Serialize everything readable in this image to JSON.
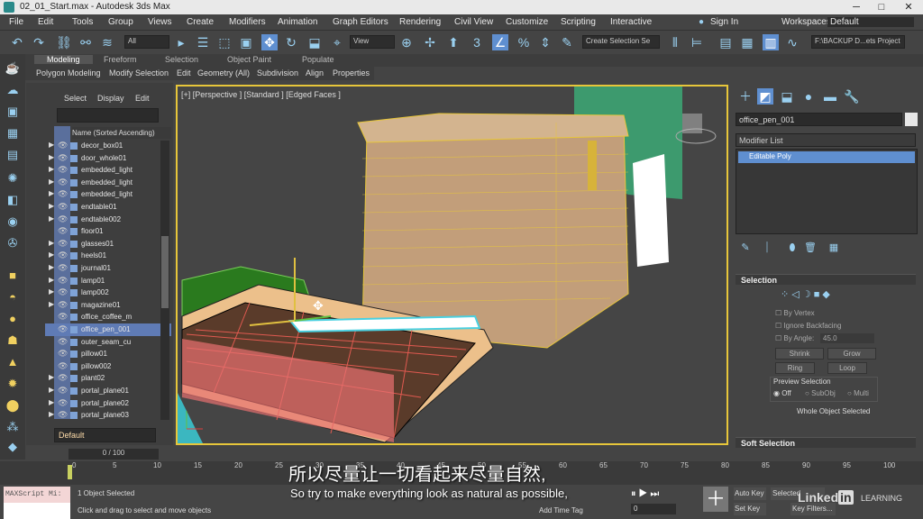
{
  "titlebar": {
    "title": "02_01_Start.max - Autodesk 3ds Max",
    "minimize": "─",
    "maximize": "□",
    "close": "✕"
  },
  "menu": [
    "File",
    "Edit",
    "Tools",
    "Group",
    "Views",
    "Create",
    "Modifiers",
    "Animation",
    "Graph Editors",
    "Rendering",
    "Civil View",
    "Customize",
    "Scripting",
    "Interactive"
  ],
  "signin": "Sign In",
  "workspaces_label": "Workspaces:",
  "workspace": "Default",
  "toolbar": {
    "filter": "All",
    "refcoord": "View",
    "selset": "Create Selection Se",
    "project": "F:\\BACKUP D...ets Project"
  },
  "ribbon_tabs": [
    "Modeling",
    "Freeform",
    "Selection",
    "Object Paint",
    "Populate"
  ],
  "ribbon_items": [
    "Polygon Modeling",
    "Modify Selection",
    "Edit",
    "Geometry (All)",
    "Subdivision",
    "Align",
    "Properties"
  ],
  "scene": {
    "tabs": [
      "Select",
      "Display",
      "Edit"
    ],
    "sort_header": "Name (Sorted Ascending)",
    "rows": [
      {
        "name": "decor_box01",
        "arrow": "▶"
      },
      {
        "name": "door_whole01",
        "arrow": "▶"
      },
      {
        "name": "embedded_light",
        "arrow": "▶"
      },
      {
        "name": "embedded_light",
        "arrow": "▶"
      },
      {
        "name": "embedded_light",
        "arrow": "▶"
      },
      {
        "name": "endtable01",
        "arrow": "▶"
      },
      {
        "name": "endtable002",
        "arrow": "▶"
      },
      {
        "name": "floor01",
        "arrow": ""
      },
      {
        "name": "glasses01",
        "arrow": "▶"
      },
      {
        "name": "heels01",
        "arrow": "▶"
      },
      {
        "name": "journal01",
        "arrow": "▶"
      },
      {
        "name": "lamp01",
        "arrow": "▶"
      },
      {
        "name": "lamp002",
        "arrow": "▶"
      },
      {
        "name": "magazine01",
        "arrow": "▶"
      },
      {
        "name": "office_coffee_m",
        "arrow": ""
      },
      {
        "name": "office_pen_001",
        "arrow": ""
      },
      {
        "name": "outer_seam_cu",
        "arrow": ""
      },
      {
        "name": "pillow01",
        "arrow": ""
      },
      {
        "name": "pillow002",
        "arrow": ""
      },
      {
        "name": "plant02",
        "arrow": "▶"
      },
      {
        "name": "portal_plane01",
        "arrow": "▶"
      },
      {
        "name": "portal_plane02",
        "arrow": "▶"
      },
      {
        "name": "portal_plane03",
        "arrow": "▶"
      }
    ],
    "layer": "Default"
  },
  "viewport_label": "[+] [Perspective ] [Standard ] [Edged Faces ]",
  "command": {
    "object_name": "office_pen_001",
    "modifier_list": "Modifier List",
    "stack_item": "Editable Poly",
    "selection_title": "Selection",
    "by_vertex": "By Vertex",
    "ignore_backfacing": "Ignore Backfacing",
    "by_angle": "By Angle:",
    "angle_value": "45.0",
    "shrink": "Shrink",
    "grow": "Grow",
    "ring": "Ring",
    "loop": "Loop",
    "preview_title": "Preview Selection",
    "off": "Off",
    "subobj": "SubObj",
    "multi": "Multi",
    "status": "Whole Object Selected",
    "soft_title": "Soft Selection"
  },
  "timeline": {
    "counter": "0 / 100",
    "ticks": [
      "0",
      "5",
      "10",
      "15",
      "20",
      "25",
      "30",
      "35",
      "40",
      "45",
      "50",
      "55",
      "60",
      "65",
      "70",
      "75",
      "80",
      "85",
      "90",
      "95",
      "100"
    ]
  },
  "status": {
    "maxscript": "MAXScript Mi:",
    "selected": "1 Object Selected",
    "prompt": "Click and drag to select and move objects",
    "add_time_tag": "Add Time Tag",
    "frame": "0",
    "auto_key": "Auto Key",
    "set_key": "Set Key",
    "selected_btn": "Selected",
    "key_filters": "Key Filters..."
  },
  "subtitle_cn": "所以尽量让一切看起来尽量自然,",
  "subtitle_en": "So try to make everything look as natural as possible,",
  "watermark": {
    "brand": "Linked",
    "suffix": "LEARNING"
  }
}
